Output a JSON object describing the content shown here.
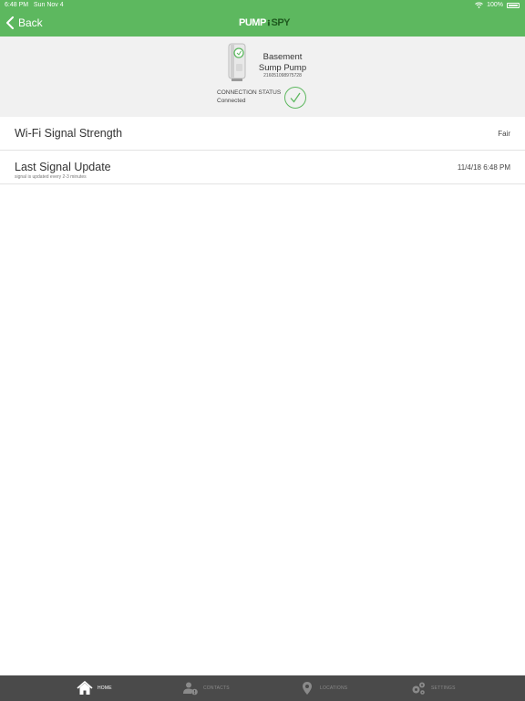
{
  "status_bar": {
    "time": "6:48 PM",
    "date": "Sun Nov 4",
    "battery": "100%",
    "wifi_icon": "wifi-icon",
    "battery_icon": "battery-icon"
  },
  "header": {
    "back_label": "Back",
    "logo_text_1": "PUMP",
    "logo_text_2": "SPY",
    "brand_color": "#5db85f"
  },
  "device": {
    "name_line1": "Basement",
    "name_line2": "Sump Pump",
    "serial": "216051098975728",
    "connection_label": "CONNECTION STATUS",
    "connection_value": "Connected",
    "status_icon": "check-circle-icon"
  },
  "rows": [
    {
      "title": "Wi-Fi Signal Strength",
      "subtitle": "",
      "value": "Fair"
    },
    {
      "title": "Last Signal Update",
      "subtitle": "signal is updated every 2-3 minutes",
      "value": "11/4/18 6:48 PM"
    }
  ],
  "tabbar": {
    "tabs": [
      {
        "label": "HOME",
        "icon": "home-icon",
        "active": true
      },
      {
        "label": "CONTACTS",
        "icon": "contacts-icon",
        "active": false
      },
      {
        "label": "LOCATIONS",
        "icon": "location-pin-icon",
        "active": false
      },
      {
        "label": "SETTINGS",
        "icon": "gears-icon",
        "active": false
      }
    ]
  }
}
